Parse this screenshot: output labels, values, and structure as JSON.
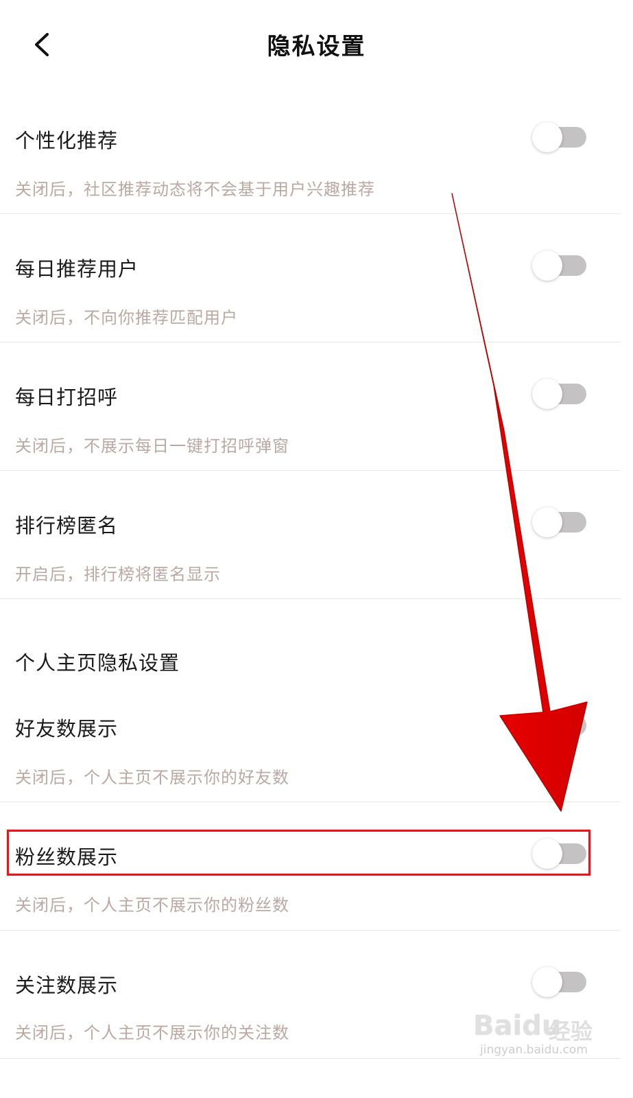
{
  "header": {
    "title": "隐私设置",
    "back_icon": "chevron-left-icon"
  },
  "settings": [
    {
      "title": "个性化推荐",
      "desc": "关闭后，社区推荐动态将不会基于用户兴趣推荐",
      "enabled": false
    },
    {
      "title": "每日推荐用户",
      "desc": "关闭后，不向你推荐匹配用户",
      "enabled": false
    },
    {
      "title": "每日打招呼",
      "desc": "关闭后，不展示每日一键打招呼弹窗",
      "enabled": false
    },
    {
      "title": "排行榜匿名",
      "desc": "开启后，排行榜将匿名显示",
      "enabled": false
    }
  ],
  "profile_section": {
    "label": "个人主页隐私设置",
    "items": [
      {
        "title": "好友数展示",
        "desc": "关闭后，个人主页不展示你的好友数",
        "enabled": false
      },
      {
        "title": "粉丝数展示",
        "desc": "关闭后，个人主页不展示你的粉丝数",
        "enabled": false,
        "highlighted": true
      },
      {
        "title": "关注数展示",
        "desc": "关闭后，个人主页不展示你的关注数",
        "enabled": false
      }
    ]
  },
  "colors": {
    "annotation": "#e8151b",
    "toggle_off": "#c4c2c2",
    "desc_text": "#bba9a1"
  },
  "watermark": {
    "brand": "Baidu",
    "cn": "经验",
    "url": "jingyan.baidu.com"
  }
}
